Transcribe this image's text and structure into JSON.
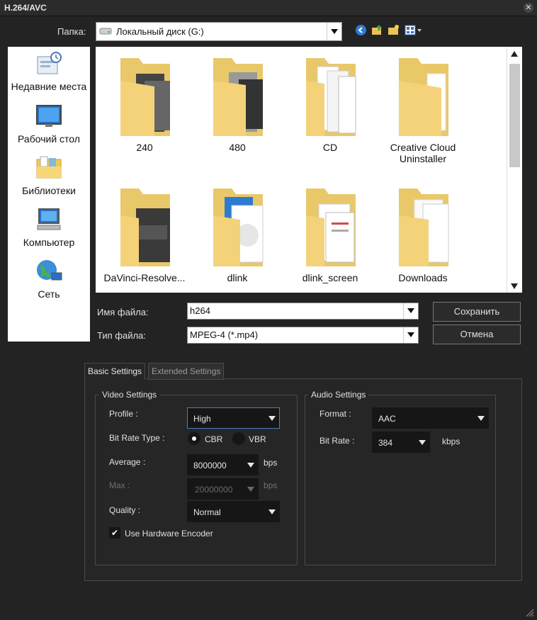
{
  "window": {
    "title": "H.264/AVC"
  },
  "toolbar": {
    "folder_label": "Папка:",
    "folder_value": "Локальный диск (G:)"
  },
  "places": [
    {
      "label": "Недавние места",
      "icon": "recent-places-icon"
    },
    {
      "label": "Рабочий стол",
      "icon": "desktop-icon"
    },
    {
      "label": "Библиотеки",
      "icon": "libraries-icon"
    },
    {
      "label": "Компьютер",
      "icon": "computer-icon"
    },
    {
      "label": "Сеть",
      "icon": "network-icon"
    }
  ],
  "folders": [
    {
      "name": "240"
    },
    {
      "name": "480"
    },
    {
      "name": "CD"
    },
    {
      "name": "Creative Cloud\nUninstaller"
    },
    {
      "name": "DaVinci-Resolve..."
    },
    {
      "name": "dlink"
    },
    {
      "name": "dlink_screen"
    },
    {
      "name": "Downloads"
    }
  ],
  "file": {
    "name_label": "Имя файла:",
    "name_value": "h264",
    "type_label": "Тип файла:",
    "type_value": "MPEG-4 (*.mp4)",
    "save_label": "Сохранить",
    "cancel_label": "Отмена"
  },
  "tabs": [
    {
      "label": "Basic Settings",
      "active": true
    },
    {
      "label": "Extended Settings",
      "active": false
    }
  ],
  "video": {
    "title": "Video Settings",
    "profile_label": "Profile :",
    "profile_value": "High",
    "bitrate_type_label": "Bit Rate Type :",
    "cbr_label": "CBR",
    "vbr_label": "VBR",
    "bitrate_type_selected": "CBR",
    "average_label": "Average :",
    "average_value": "8000000",
    "average_unit": "bps",
    "max_label": "Max :",
    "max_value": "20000000",
    "max_unit": "bps",
    "quality_label": "Quality :",
    "quality_value": "Normal",
    "hw_label": "Use Hardware Encoder",
    "hw_checked": true
  },
  "audio": {
    "title": "Audio Settings",
    "format_label": "Format :",
    "format_value": "AAC",
    "bitrate_label": "Bit Rate :",
    "bitrate_value": "384",
    "bitrate_unit": "kbps"
  },
  "colors": {
    "background": "#232323",
    "panel": "#262626",
    "focus_border": "#4a7fc0",
    "folder_yellow": "#f3d27a"
  }
}
